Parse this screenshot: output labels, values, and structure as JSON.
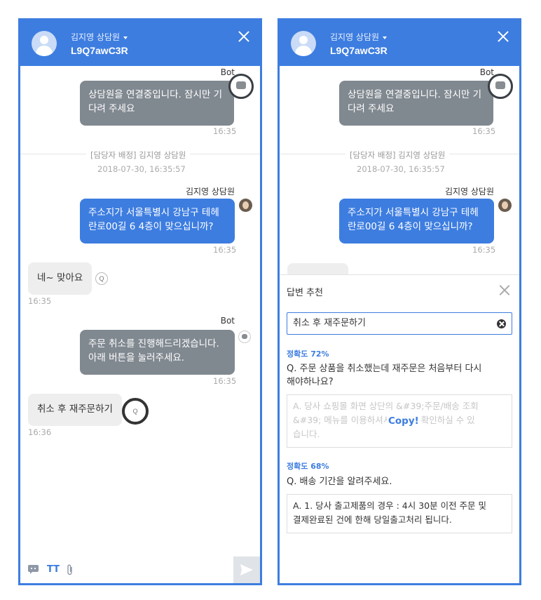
{
  "header": {
    "agent_name": "김지영 상담원",
    "chat_code": "L9Q7awC3R"
  },
  "messages": {
    "bot_sender": "Bot",
    "bot_msg1": [
      "상담원을 연결중입니다. 잠시만 기",
      "다려 주세요"
    ],
    "bot_msg1_time": "16:35",
    "sys_assign": "[담당자 배정] 김지영 상담원",
    "sys_assign_time": "2018-07-30, 16:35:57",
    "agent_sender": "김지영 상담원",
    "agent_msg": [
      "주소지가 서울특별시 강남구 테헤",
      "란로00길 6 4층이 맞으십니까?"
    ],
    "agent_msg_time": "16:35",
    "user_msg1": "네~ 맞아요",
    "user_msg1_time": "16:35",
    "bot_msg2": [
      "주문 취소를 진행해드리겠습니다.",
      "아래 버튼을 눌러주세요."
    ],
    "bot_msg2_time": "16:35",
    "user_msg2": "취소 후 재주문하기",
    "user_msg2_time": "16:36",
    "q_badge": "Q"
  },
  "footer": {
    "text_format_label": "TT"
  },
  "recommend": {
    "title": "답변 추천",
    "search_value": "취소 후 재주문하기",
    "items": [
      {
        "accuracy": "정확도 72%",
        "question": [
          "Q. 주문 상품을 취소했는데 재주문은 처음부터 다시",
          "해야하나요?"
        ],
        "answer": [
          "A. 당사 쇼핑몰 화면 상단의 &#39;주문/배송 조회",
          "&#39; 메뉴를 이용하셔서 과정을 확인하실 수 있",
          "습니다."
        ],
        "copy_label": "Copy!"
      },
      {
        "accuracy": "정확도 68%",
        "question": [
          "Q. 배송 기간을 알려주세요."
        ],
        "answer": [
          "A. 1. 당사 출고제품의 경우 : 4시 30분 이전 주문 및",
          "결제완료된 건에 한해 당일출고처리 됩니다."
        ]
      }
    ]
  },
  "colors": {
    "accent": "#3d7de0",
    "bot_bubble": "#808890",
    "user_bubble": "#eeeeee"
  }
}
